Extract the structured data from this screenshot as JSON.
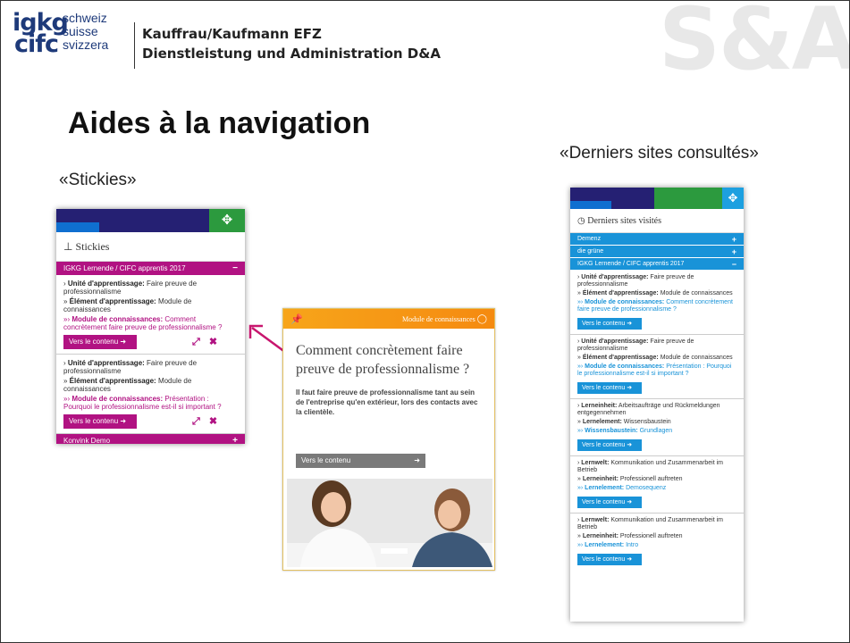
{
  "header": {
    "logo_top": "igkg",
    "logo_bottom": "cifc",
    "logo_langs": [
      "schweiz",
      "suisse",
      "svizzera"
    ],
    "line1": "Kauffrau/Kaufmann EFZ",
    "line2": "Dienstleistung und Administration D&A",
    "watermark": "S&A"
  },
  "slide": {
    "title": "Aides à la navigation",
    "label_left": "«Stickies»",
    "label_right": "«Derniers sites consultés»"
  },
  "stickies": {
    "title": "Stickies",
    "group1": "IGKG Lernende / CIFC apprentis 2017",
    "entries": [
      {
        "l1_key": "Unité d'apprentissage:",
        "l1_val": " Faire preuve de professionnalisme",
        "l2_key": "Élément d'apprentissage:",
        "l2_val": " Module de connaissances",
        "l3_key": "Module de connaissances:",
        "l3_val": " Comment concrètement faire preuve de professionnalisme ?",
        "btn": "Vers le contenu"
      },
      {
        "l1_key": "Unité d'apprentissage:",
        "l1_val": " Faire preuve de professionnalisme",
        "l2_key": "Élément d'apprentissage:",
        "l2_val": " Module de connaissances",
        "l3_key": "Module de connaissances:",
        "l3_val": " Présentation : Pourquoi le professionnalisme est-il si important ?",
        "btn": "Vers le contenu"
      }
    ],
    "group2": "Konvink Demo"
  },
  "card": {
    "header": "Module de connaissances",
    "title": "Comment concrètement faire preuve de professionnalisme ?",
    "text": "Il faut faire preuve de professionnalisme tant au sein de l'entreprise qu'en extérieur, lors des contacts avec la clientèle.",
    "btn": "Vers le contenu"
  },
  "recent": {
    "title": "Derniers sites visités",
    "bars": [
      "Demenz",
      "die grüne",
      "IGKG Lernende / CIFC apprentis 2017"
    ],
    "entries": [
      {
        "l1_key": "Unité d'apprentissage:",
        "l1_val": " Faire preuve de professionnalisme",
        "l2_key": "Élément d'apprentissage:",
        "l2_val": " Module de connaissances",
        "l3_key": "Module de connaissances:",
        "l3_val": " Comment concrètement faire preuve de professionnalisme ?",
        "btn": "Vers le contenu"
      },
      {
        "l1_key": "Unité d'apprentissage:",
        "l1_val": " Faire preuve de professionnalisme",
        "l2_key": "Élément d'apprentissage:",
        "l2_val": " Module de connaissances",
        "l3_key": "Module de connaissances:",
        "l3_val": " Présentation : Pourquoi le professionnalisme est-il si important ?",
        "btn": "Vers le contenu"
      },
      {
        "l1_key": "Lerneinheit:",
        "l1_val": " Arbeitsaufträge und Rückmeldungen entgegennehmen",
        "l2_key": "Lernelement:",
        "l2_val": " Wissensbaustein",
        "l3_key": "Wissensbaustein:",
        "l3_val": " Grundlagen",
        "btn": "Vers le contenu"
      },
      {
        "l1_key": "Lernwelt:",
        "l1_val": " Kommunikation und Zusammenarbeit im Betrieb",
        "l2_key": "Lerneinheit:",
        "l2_val": " Professionell auftreten",
        "l3_key": "Lernelement:",
        "l3_val": " Demosequenz",
        "btn": "Vers le contenu"
      },
      {
        "l1_key": "Lernwelt:",
        "l1_val": " Kommunikation und Zusammenarbeit im Betrieb",
        "l2_key": "Lerneinheit:",
        "l2_val": " Professionell auftreten",
        "l3_key": "Lernelement:",
        "l3_val": " Intro",
        "btn": "Vers le contenu"
      }
    ]
  },
  "colors": {
    "magenta": "#b11282",
    "blue": "#1993d8",
    "navy": "#252073",
    "green": "#2c9a3e",
    "orange": "#f7a51a"
  },
  "icons": [
    "move-icon",
    "pin-icon",
    "expand-icon",
    "close-icon",
    "clock-icon",
    "plus-icon",
    "minus-icon",
    "arrow-right-icon",
    "lightbulb-icon"
  ]
}
